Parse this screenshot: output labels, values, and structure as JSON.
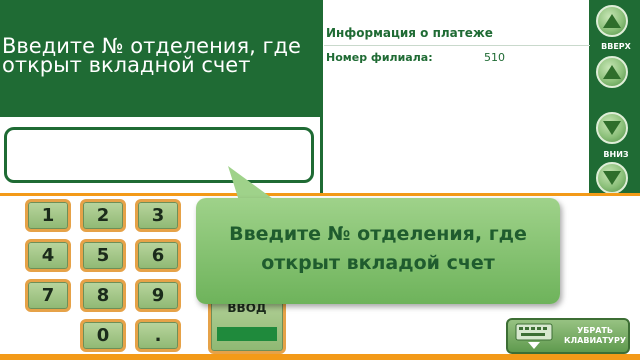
{
  "prompt": {
    "line1": "Введите № отделения, где",
    "line2": "открыт вкладной счет"
  },
  "info": {
    "title": "Информация о платеже",
    "branch_label": "Номер филиала:",
    "branch_value": "510"
  },
  "scroll": {
    "up_label": "ВВЕРХ",
    "down_label": "ВНИЗ"
  },
  "keypad": {
    "keys": [
      "1",
      "2",
      "3",
      "4",
      "5",
      "6",
      "7",
      "8",
      "9",
      "0",
      "."
    ],
    "enter_label": "ВВОД"
  },
  "tooltip": {
    "line1": "Введите № отделения, где",
    "line2": "открыт вкладой счет"
  },
  "hide_keyboard": {
    "line1": "УБРАТЬ",
    "line2": "КЛАВИАТУРУ"
  },
  "colors": {
    "brand_green": "#1f6b34",
    "accent_orange": "#f39a18"
  }
}
